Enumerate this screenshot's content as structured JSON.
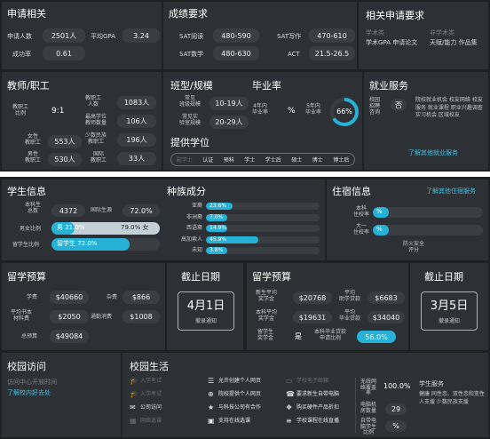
{
  "top": {
    "apply": {
      "title": "申请相关",
      "applicants_label": "申请人数",
      "applicants_value": "2501人",
      "gpa_label": "平均GPA",
      "gpa_value": "3.24",
      "success_label": "成功率",
      "success_value": "0.61"
    },
    "scores": {
      "title": "成绩要求",
      "sat_read_label": "SAT阅读",
      "sat_read_value": "480-590",
      "sat_write_label": "SAT写作",
      "sat_write_value": "470-610",
      "sat_math_label": "SAT数学",
      "sat_math_value": "480-630",
      "act_label": "ACT",
      "act_value": "21.5-26.5"
    },
    "reqs": {
      "title": "相关申请要求",
      "col1_head": "学术类",
      "col1_items": "学术GPA 申请论文",
      "col2_head": "非学术类",
      "col2_items": "天赋/能力 作品集"
    },
    "faculty": {
      "title": "教师/职工",
      "ratio_label": "教职工\n比例",
      "ratio_value": "9:1",
      "fac_label": "教职工\n人数",
      "fac_value": "1083人",
      "high_label": "最高学位\n教师数量",
      "high_value": "106人",
      "female_label": "女性\n教职工",
      "female_value": "553人",
      "minority_label": "少数民族\n教职工",
      "minority_value": "196人",
      "male_label": "男性\n教职工",
      "male_value": "530人",
      "intl_label": "国际\n教职工",
      "intl_value": "33人"
    },
    "classes": {
      "title": "班型/规模",
      "small_label": "常见\n班级规模",
      "small_value": "10-19人",
      "lab_label": "常见实\n验室规模",
      "lab_value": "20-29人",
      "degree_title": "提供学位",
      "degrees": [
        "副学士",
        "认证",
        "预科",
        "学士",
        "学士后",
        "硕士",
        "博士",
        "博士后"
      ]
    },
    "graduation": {
      "title": "毕业率",
      "four_label": "4年内\n毕业率",
      "four_value": "%",
      "five_label": "5年内\n毕业率",
      "five_value": "66%",
      "five_pct": 66
    },
    "career": {
      "title": "就业服务",
      "recruit_label": "校园\n招聘\n咨询",
      "recruit_value": "否",
      "items": "院校就业机会 校友网络 校友服务 就业课程 职业兴趣调查 实习机会 区域校友",
      "link": "了解其他就业服务"
    }
  },
  "bottom": {
    "students": {
      "title": "学生信息",
      "total_label": "本科生\n总数",
      "total_value": "4372",
      "intl_label": "国际生源",
      "intl_value": "72.0%",
      "gender_label": "男女比例",
      "male_text": "男 21.0%",
      "female_text": "79.0% 女",
      "male_pct": 21,
      "abroad_label": "留学生比例",
      "abroad_text": "留学生 72.0%",
      "abroad_pct": 72
    },
    "race": {
      "title": "种族成分",
      "rows": [
        {
          "label": "亚裔",
          "value": "23.6%",
          "pct": 23.6
        },
        {
          "label": "非洲裔",
          "value": "7.0%",
          "pct": 7.0
        },
        {
          "label": "西语裔",
          "value": "14.9%",
          "pct": 14.9
        },
        {
          "label": "高加索人",
          "value": "45.9%",
          "pct": 45.9
        },
        {
          "label": "未知",
          "value": "3.8%",
          "pct": 3.8
        }
      ]
    },
    "housing": {
      "title": "住宿信息",
      "link": "了解其他住宿服务",
      "ug_label": "本科\n住校率",
      "ug_value": "%",
      "fresh_label": "大一\n住校率",
      "fresh_value": "%",
      "safety_label": "防火安全\n评分"
    },
    "budget": {
      "title": "留学预算",
      "tuition_label": "学费",
      "tuition_value": "$40660",
      "misc_label": "杂费",
      "misc_value": "$866",
      "books_label": "平均书本\n材料费",
      "books_value": "$2050",
      "transport_label": "通勤消费",
      "transport_value": "$1008",
      "total_label": "总预算",
      "total_value": "$49084"
    },
    "deadline1": {
      "title": "截止日期",
      "date": "4月1日",
      "note": "撤录通知"
    },
    "aid": {
      "title": "留学预算",
      "new_label": "新生平均\n奖学金",
      "new_value": "$20768",
      "avg_aid_label": "平均\n助学贷款",
      "avg_aid_value": "$6683",
      "ug_label": "本科平均\n奖学金",
      "ug_value": "$19631",
      "grad_label": "平均\n毕业贷款",
      "grad_value": "$34040",
      "scholar_label": "留学生\n奖学金",
      "scholar_value": "是",
      "rate_label": "本科毕业贷款\n申请比例",
      "rate_value": "56.0%"
    },
    "deadline2": {
      "title": "截止日期",
      "date": "3月5日",
      "note": "撤录通知"
    },
    "visit": {
      "title": "校园访问",
      "status": "访问中心开放时间",
      "link": "了解校内好去处"
    },
    "life": {
      "title": "校园生活",
      "items": [
        {
          "icon": "student-icon",
          "label": "入学考试",
          "active": false
        },
        {
          "icon": "doc-icon",
          "label": "允许创建个人网页",
          "active": true
        },
        {
          "icon": "laptop-icon",
          "label": "学校电子邮箱",
          "active": false
        },
        {
          "icon": "student-icon",
          "label": "入学考试",
          "active": false
        },
        {
          "icon": "globe-icon",
          "label": "院校提供个人网页",
          "active": true
        },
        {
          "icon": "phone-icon",
          "label": "要求新生自带电脑",
          "active": true
        },
        {
          "icon": "chat-icon",
          "label": "公司访问",
          "active": true
        },
        {
          "icon": "handshake-icon",
          "label": "与科技公司有合作",
          "active": true
        },
        {
          "icon": "cart-icon",
          "label": "购买硬件产品折扣",
          "active": true
        },
        {
          "icon": "net-icon",
          "label": "网络选课",
          "active": false
        },
        {
          "icon": "monitor-icon",
          "label": "支持在线选课",
          "active": true
        },
        {
          "icon": "book-icon",
          "label": "学校课程在线直播",
          "active": true
        }
      ],
      "wifi_label": "无线网\n络覆盖\n率",
      "wifi_value": "100.0%",
      "ereader_label": "电脑机\n房数量",
      "ereader_value": "29",
      "comp_label": "自带电\n脑学生\n比例",
      "comp_value": "%",
      "service_title": "学生服务",
      "service_items": "健康 同性恋、双性恋和变性人支援 少数民族支援"
    }
  }
}
